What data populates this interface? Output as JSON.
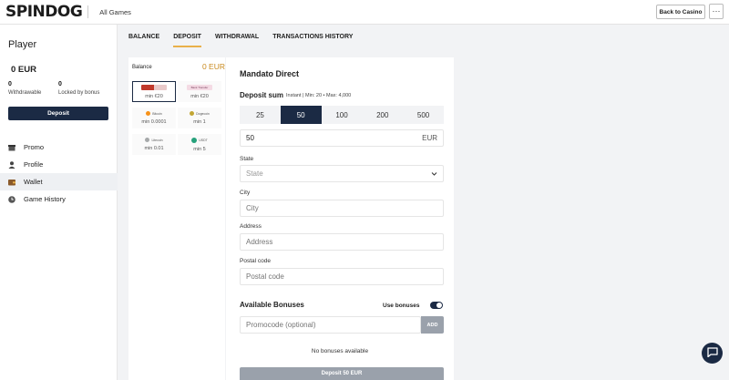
{
  "topbar": {
    "logo": "SPINDOG",
    "all_games": "All Games",
    "back_to_casino": "Back to Casino",
    "more": "···"
  },
  "sidebar": {
    "title": "Player",
    "balance": "0  EUR",
    "withdrawable_value": "0",
    "withdrawable_label": "Withdrawable",
    "locked_value": "0",
    "locked_label": "Locked by bonus",
    "deposit_label": "Deposit",
    "items": [
      {
        "label": "Promo",
        "icon": "promo-icon"
      },
      {
        "label": "Profile",
        "icon": "profile-icon"
      },
      {
        "label": "Wallet",
        "icon": "wallet-icon",
        "active": true
      },
      {
        "label": "Game History",
        "icon": "game-history-icon"
      }
    ]
  },
  "tabs": [
    "BALANCE",
    "DEPOSIT",
    "WITHDRAWAL",
    "TRANSACTIONS HISTORY"
  ],
  "active_tab": "DEPOSIT",
  "methods": {
    "balance_label": "Balance",
    "balance_value": "0 EUR",
    "cards": [
      {
        "min": "min €20",
        "selected": true
      },
      {
        "min": "min €20",
        "logo_text": "Bank Transfer"
      },
      {
        "min": "min 0.0001",
        "logo_text": "Bitcoin"
      },
      {
        "min": "min 1",
        "logo_text": "Dogecoin"
      },
      {
        "min": "min 0.01",
        "logo_text": "Litecoin"
      },
      {
        "min": "min 5",
        "logo_text": "USDT"
      }
    ]
  },
  "form": {
    "title": "Mandato Direct",
    "sum_label": "Deposit sum",
    "sum_note": "Instant | Min: 20 • Max: 4,000",
    "amounts": [
      "25",
      "50",
      "100",
      "200",
      "500"
    ],
    "selected_amount": "50",
    "amount_value": "50",
    "currency": "EUR",
    "state_label": "State",
    "state_placeholder": "State",
    "city_label": "City",
    "city_placeholder": "City",
    "address_label": "Address",
    "address_placeholder": "Address",
    "postal_label": "Postal code",
    "postal_placeholder": "Postal code",
    "bonuses_title": "Available Bonuses",
    "use_bonuses_label": "Use bonuses",
    "use_bonuses_on": true,
    "promocode_placeholder": "Promocode (optional)",
    "add_label": "ADD",
    "no_bonuses": "No bonuses available",
    "submit_label": "Deposit 50 EUR"
  },
  "colors": {
    "navy": "#1b2a44",
    "accent": "#e9b04a",
    "balance_accent": "#c98a1e"
  }
}
